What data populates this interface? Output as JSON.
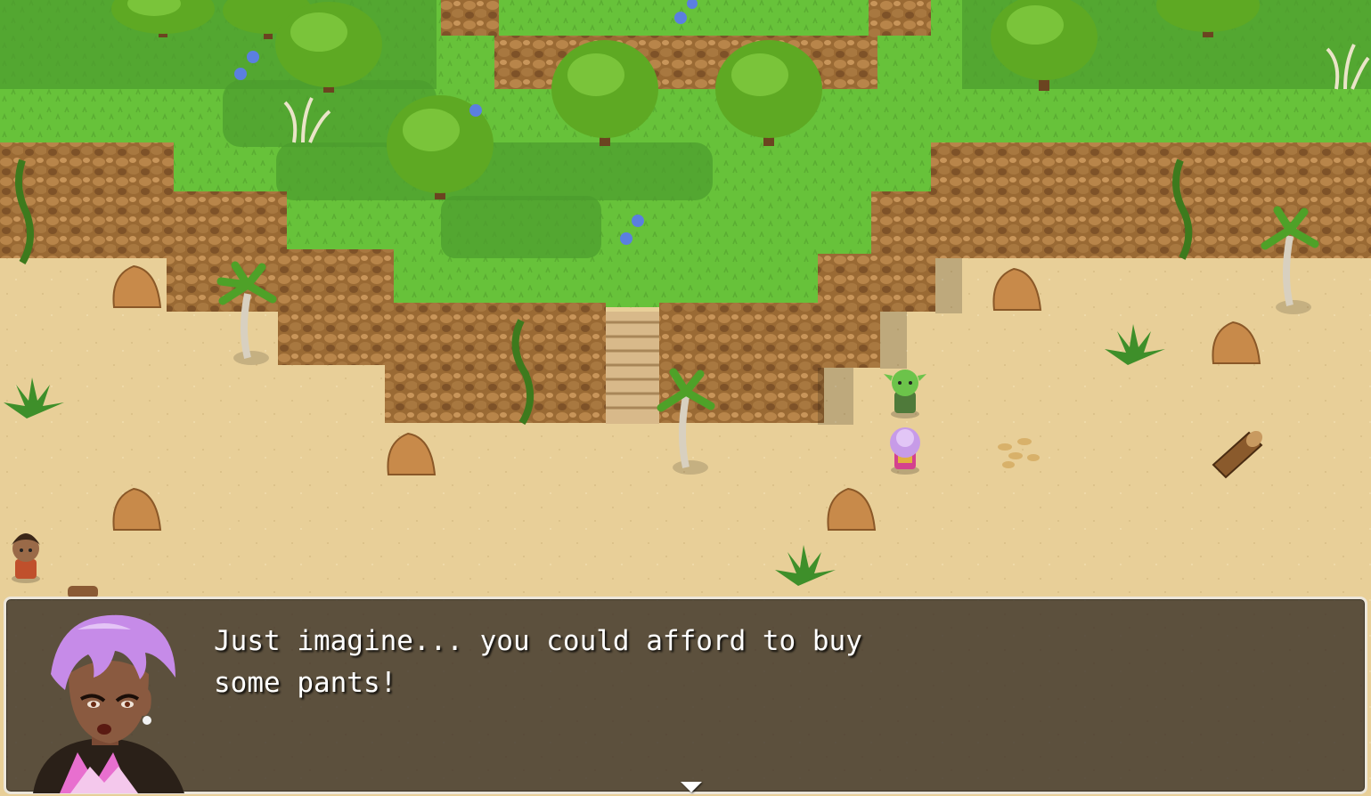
{
  "scene": {
    "colors": {
      "sand": "#e8cf98",
      "grass_light": "#67c23a",
      "grass_dark": "#4b9b2e",
      "cliff": "#9a6a34",
      "cliff_dark": "#6b4420",
      "tree": "#5ea923",
      "tree_dark": "#3b7a17"
    },
    "characters": [
      {
        "name": "goblin-npc",
        "color": "#6cc34a"
      },
      {
        "name": "player-character",
        "color": "#c79be8"
      },
      {
        "name": "villager-npc",
        "color": "#3a2618"
      }
    ]
  },
  "dialog": {
    "line1": "Just imagine... you could afford to buy",
    "line2": "some pants!",
    "continue_icon": "down-triangle-icon"
  }
}
